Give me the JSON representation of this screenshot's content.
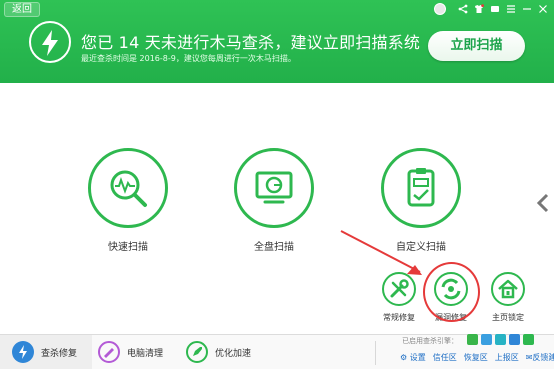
{
  "header": {
    "back_label": "返回",
    "headline": "您已 14 天未进行木马查杀，建议立即扫描系统",
    "subline": "最近查杀时间是 2016-8-9，建议您每周进行一次木马扫描。",
    "scan_button": "立即扫描"
  },
  "tools": [
    {
      "label": "快速扫描"
    },
    {
      "label": "全盘扫描"
    },
    {
      "label": "自定义扫描"
    }
  ],
  "small_tools": [
    {
      "label": "常规修复"
    },
    {
      "label": "漏洞修复"
    },
    {
      "label": "主页锁定"
    }
  ],
  "bottom": {
    "tabs": [
      {
        "label": "查杀修复"
      },
      {
        "label": "电脑清理"
      },
      {
        "label": "优化加速"
      }
    ],
    "ext_label": "已启用查杀引擎：",
    "links": [
      "设置",
      "信任区",
      "恢复区",
      "上报区",
      "反馈建议"
    ]
  },
  "colors": {
    "green": "#2eb84f",
    "header": "#22b04a",
    "red": "#e53a3a",
    "link": "#1f6fc5"
  }
}
